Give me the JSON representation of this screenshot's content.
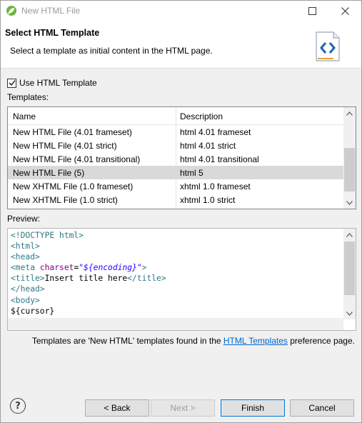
{
  "window": {
    "title": "New HTML File"
  },
  "banner": {
    "heading": "Select HTML Template",
    "subtitle": "Select a template as initial content in the HTML page."
  },
  "options": {
    "use_template_label": "Use HTML Template",
    "use_template_checked": true,
    "templates_label": "Templates:"
  },
  "templates": {
    "columns": [
      "Name",
      "Description"
    ],
    "rows": [
      {
        "name": "New HTML File (4.01 frameset)",
        "description": "html 4.01 frameset",
        "selected": false
      },
      {
        "name": "New HTML File (4.01 strict)",
        "description": "html 4.01 strict",
        "selected": false
      },
      {
        "name": "New HTML File (4.01 transitional)",
        "description": "html 4.01 transitional",
        "selected": false
      },
      {
        "name": "New HTML File (5)",
        "description": "html 5",
        "selected": true
      },
      {
        "name": "New XHTML File (1.0 frameset)",
        "description": "xhtml 1.0 frameset",
        "selected": false
      },
      {
        "name": "New XHTML File (1.0 strict)",
        "description": "xhtml 1.0 strict",
        "selected": false
      }
    ]
  },
  "preview": {
    "label": "Preview:",
    "lines": [
      "<!DOCTYPE html>",
      "<html>",
      "<head>",
      "<meta charset=\"${encoding}\">",
      "<title>Insert title here</title>",
      "</head>",
      "<body>",
      "${cursor}"
    ]
  },
  "footer": {
    "note_prefix": "Templates are 'New HTML' templates found in the ",
    "note_link": "HTML Templates",
    "note_suffix": " preference page."
  },
  "buttons": {
    "help": "?",
    "back": "< Back",
    "next": "Next >",
    "finish": "Finish",
    "cancel": "Cancel"
  },
  "colors": {
    "tag": "#2e7a85",
    "attribute": "#7f007f",
    "string": "#2a00ff",
    "link": "#0066cc",
    "selected_row": "#d9d9d9"
  }
}
